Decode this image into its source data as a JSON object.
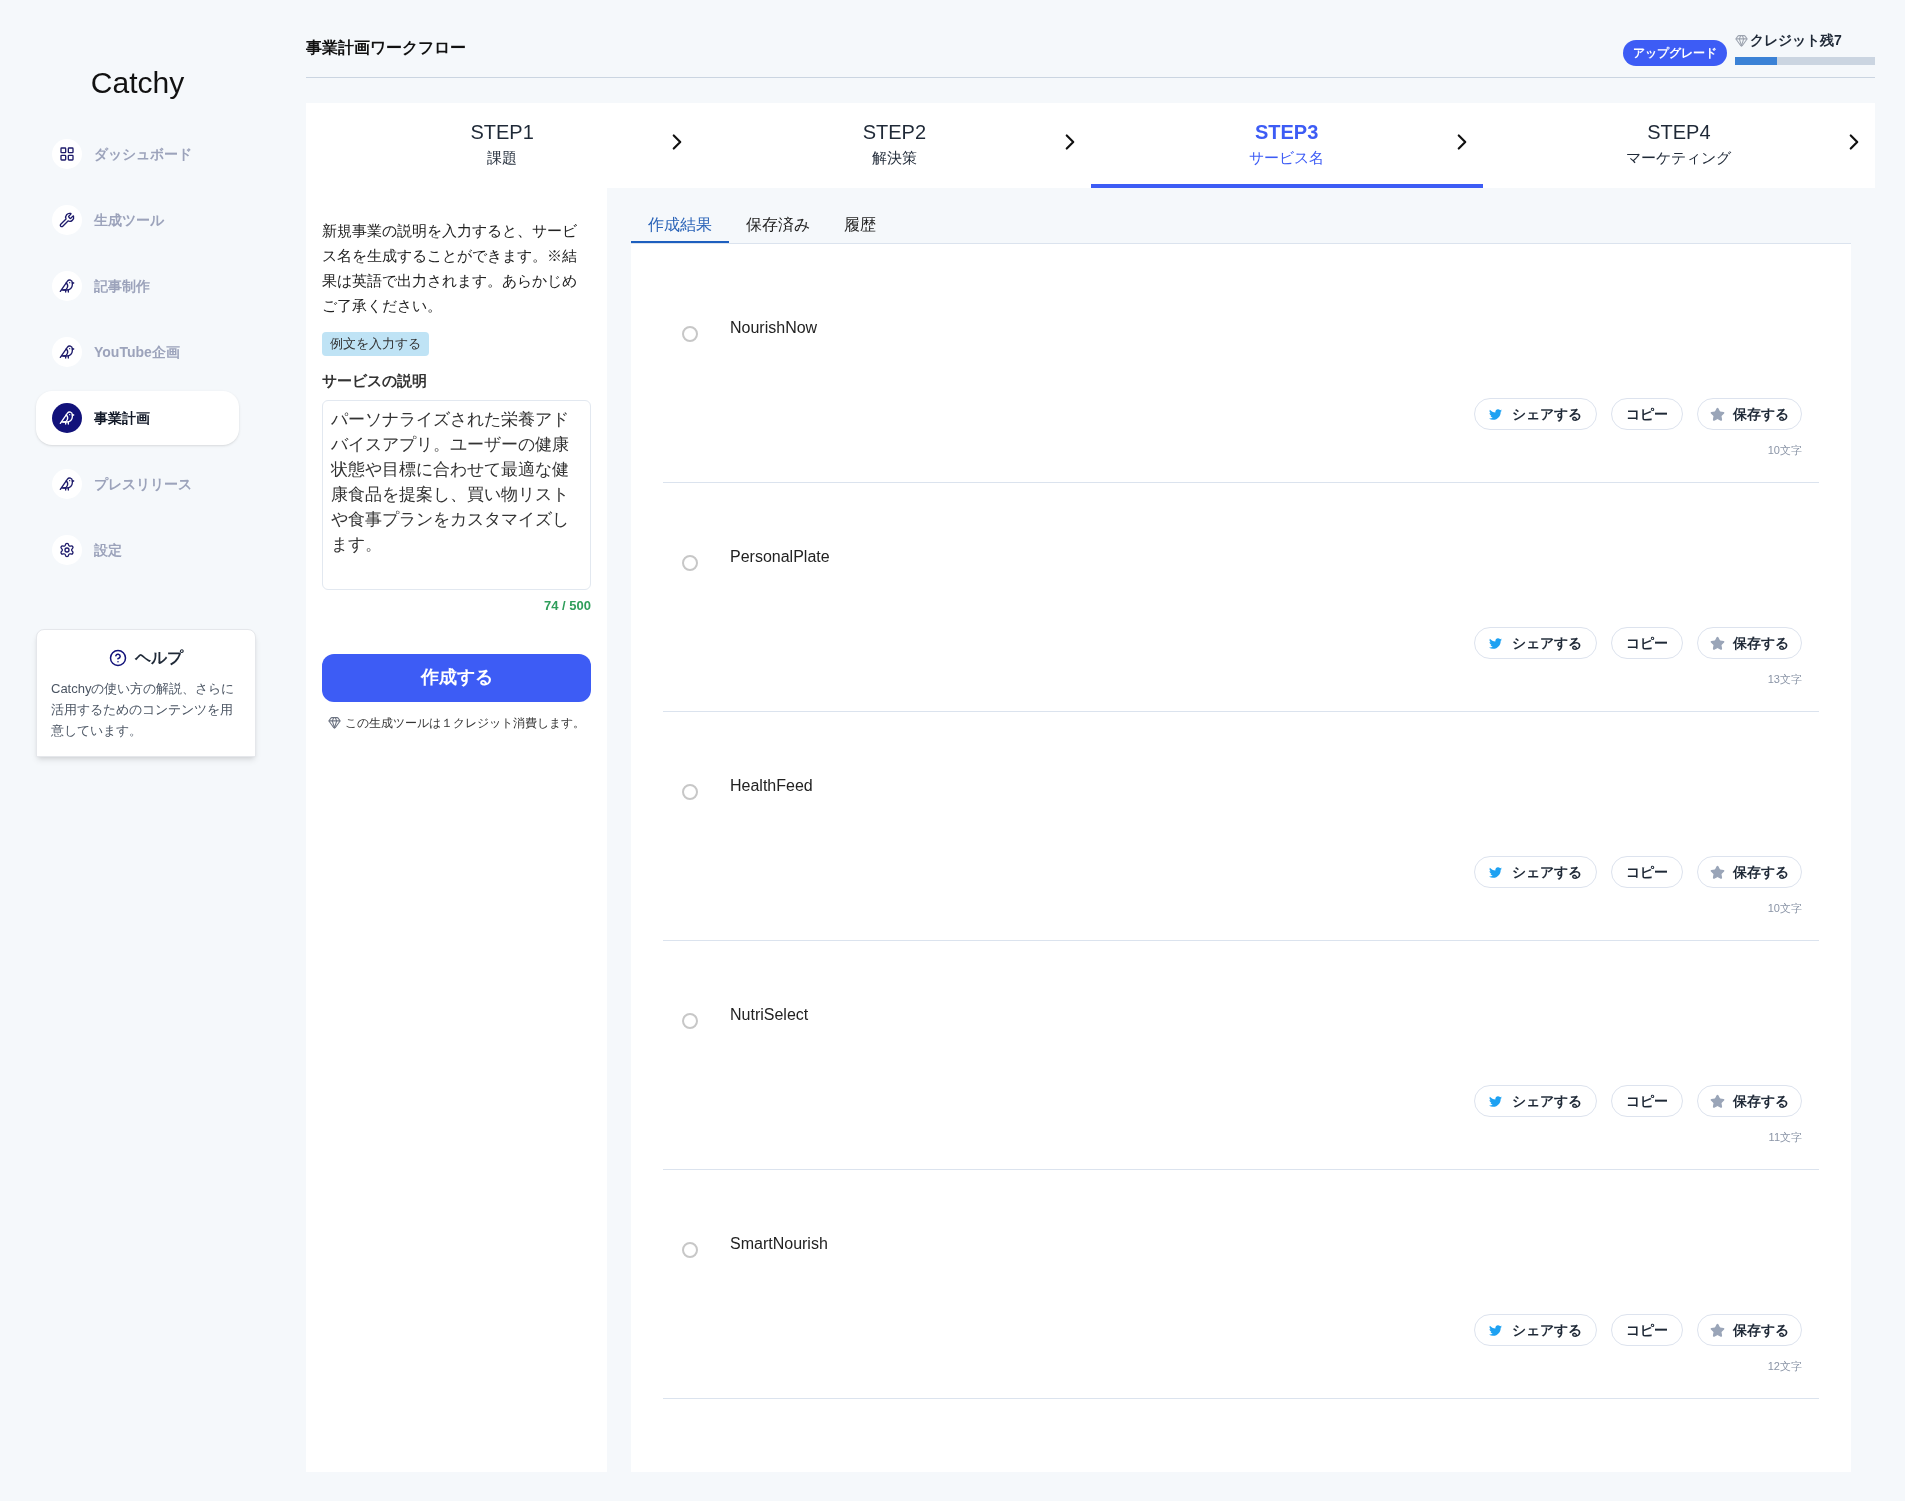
{
  "sidebar": {
    "logo": "Catchy",
    "items": [
      {
        "label": "ダッシュボード",
        "kind": "grid",
        "selected": false
      },
      {
        "label": "生成ツール",
        "kind": "wrench",
        "selected": false
      },
      {
        "label": "記事制作",
        "kind": "bird",
        "selected": false
      },
      {
        "label": "YouTube企画",
        "kind": "bird",
        "selected": false
      },
      {
        "label": "事業計画",
        "kind": "bird",
        "selected": true
      },
      {
        "label": "プレスリリース",
        "kind": "bird",
        "selected": false
      },
      {
        "label": "設定",
        "kind": "gear",
        "selected": false
      }
    ],
    "help": {
      "title": "ヘルプ",
      "text": "Catchyの使い方の解説、さらに活用するためのコンテンツを用意しています。"
    }
  },
  "header": {
    "title": "事業計画ワークフロー",
    "upgrade": "アップグレード",
    "credits": "クレジット残7",
    "credit_bar": {
      "level": 0.3
    }
  },
  "steps": [
    {
      "label": "STEP1",
      "sub": "課題",
      "selected": false
    },
    {
      "label": "STEP2",
      "sub": "解決策",
      "selected": false
    },
    {
      "label": "STEP3",
      "sub": "サービス名",
      "selected": true
    },
    {
      "label": "STEP4",
      "sub": "マーケティング",
      "selected": false
    }
  ],
  "form": {
    "intro": "新規事業の説明を入力すると、サービス名を生成することができます。※結果は英語で出力されます。あらかじめご了承ください。",
    "example_button": "例文を入力する",
    "field_label": "サービスの説明",
    "field_value": "パーソナライズされた栄養アドバイスアプリ。ユーザーの健康状態や目標に合わせて最適な健康食品を提案し、買い物リストや食事プランをカスタマイズします。",
    "counter": "74 / 500",
    "submit": "作成する",
    "note": "この生成ツールは１クレジット消費します。"
  },
  "result_tabs": [
    {
      "label": "作成結果",
      "selected": true
    },
    {
      "label": "保存済み",
      "selected": false
    },
    {
      "label": "履歴",
      "selected": false
    }
  ],
  "results": [
    {
      "name": "NourishNow",
      "checked": false,
      "share": "シェアする",
      "copy": "コピー",
      "save": "保存する",
      "count": "10文字"
    },
    {
      "name": "PersonalPlate",
      "checked": false,
      "share": "シェアする",
      "copy": "コピー",
      "save": "保存する",
      "count": "13文字"
    },
    {
      "name": "HealthFeed",
      "checked": false,
      "share": "シェアする",
      "copy": "コピー",
      "save": "保存する",
      "count": "10文字"
    },
    {
      "name": "NutriSelect",
      "checked": false,
      "share": "シェアする",
      "copy": "コピー",
      "save": "保存する",
      "count": "11文字"
    },
    {
      "name": "SmartNourish",
      "checked": false,
      "share": "シェアする",
      "copy": "コピー",
      "save": "保存する",
      "count": "12文字"
    }
  ]
}
